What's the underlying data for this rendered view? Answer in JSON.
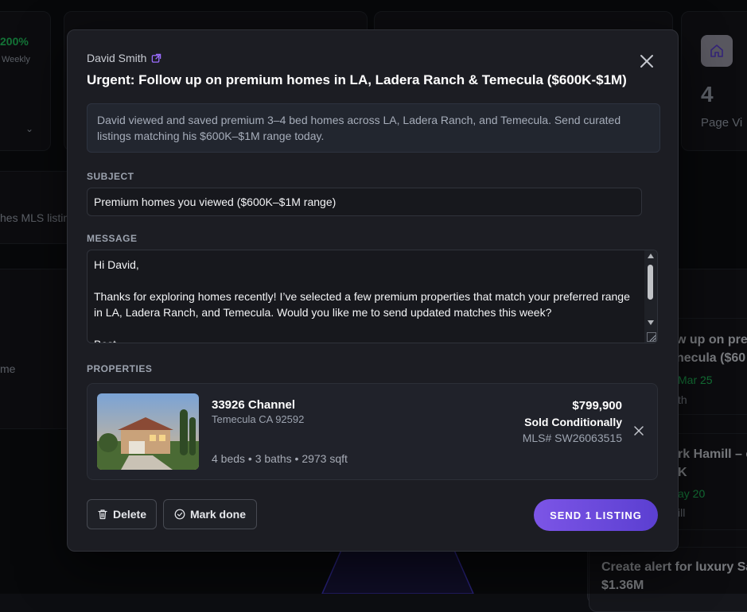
{
  "background": {
    "stat_percent": "200%",
    "stat_period": "Weekly",
    "page_views_count": "4",
    "page_views_label": "Page Vi",
    "snippet_mls": "hes MLS listin",
    "snippet_me": "me",
    "task1_title_line1": "w up on pre",
    "task1_title_line2": "necula ($60",
    "task1_date": "Mar 25",
    "task1_owner": "th",
    "task2_title_line1": "rk Hamill – c",
    "task2_title_line2": "K",
    "task2_date": "ay 20",
    "task2_owner": "ill",
    "task3_title_line1": "Create alert for luxury Sa",
    "task3_title_line2": "$1.36M",
    "colors": {
      "green": "#22c55e",
      "accent": "#7c55e6"
    }
  },
  "modal": {
    "contact_name": "David Smith",
    "title": "Urgent: Follow up on premium homes in LA, Ladera Ranch & Temecula ($600K-$1M)",
    "summary": "David viewed and saved premium 3–4 bed homes across LA, Ladera Ranch, and Temecula. Send curated listings matching his $600K–$1M range today.",
    "subject_label": "SUBJECT",
    "subject_value": "Premium homes you viewed ($600K–$1M range)",
    "message_label": "MESSAGE",
    "message_value": "Hi David,\n\nThanks for exploring homes recently! I’ve selected a few premium properties that match your preferred range in LA, Ladera Ranch, and Temecula. Would you like me to send updated matches this week?\n\nBest,",
    "properties_label": "PROPERTIES",
    "property": {
      "street": "33926 Channel",
      "city": "Temecula CA 92592",
      "specs": "4 beds • 3 baths • 2973 sqft",
      "price": "$799,900",
      "status": "Sold Conditionally",
      "mls": "MLS# SW26063515"
    },
    "delete_label": "Delete",
    "mark_done_label": "Mark done",
    "send_label": "SEND 1 LISTING"
  }
}
